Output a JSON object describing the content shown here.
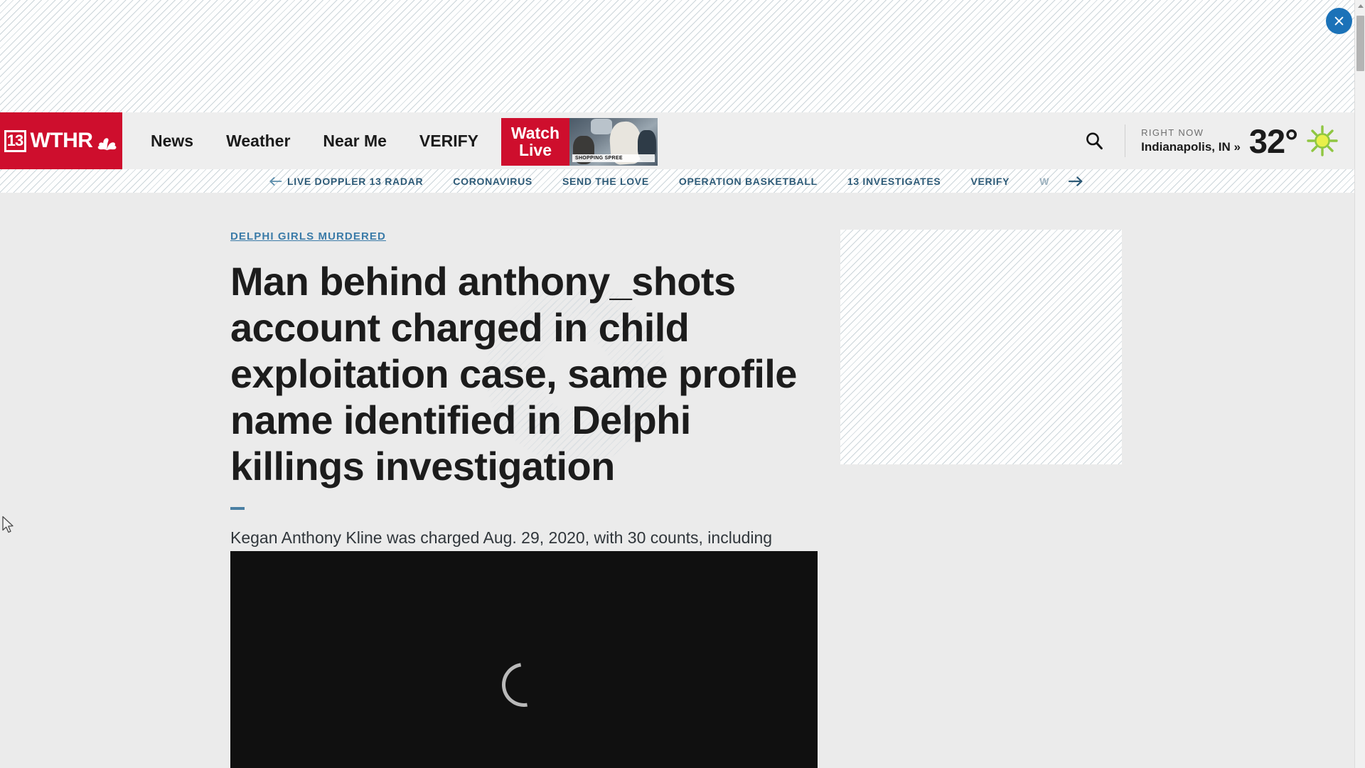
{
  "ad_top": {
    "close_label": "Close ad",
    "icon": "close-icon"
  },
  "scrollbar": {
    "up_icon": "scroll-up-arrow-icon"
  },
  "header": {
    "logo": {
      "channel_number": "13",
      "callsign": "WTHR",
      "network_icon": "nbc-peacock-icon"
    },
    "nav": [
      {
        "label": "News"
      },
      {
        "label": "Weather"
      },
      {
        "label": "Near Me"
      },
      {
        "label": "VERIFY"
      }
    ],
    "watch_live": {
      "line1": "Watch",
      "line2": "Live",
      "thumbnail_chyron": "SHOPPING SPREE"
    },
    "search": {
      "icon": "search-icon",
      "label": "Search"
    },
    "weather": {
      "right_now_label": "RIGHT NOW",
      "location": "Indianapolis, IN »",
      "temperature": "32°",
      "condition_icon": "sun-icon"
    }
  },
  "subnav": {
    "prev_icon": "arrow-left-icon",
    "next_icon": "arrow-right-icon",
    "links": [
      {
        "label": "LIVE DOPPLER 13 RADAR"
      },
      {
        "label": "CORONAVIRUS"
      },
      {
        "label": "SEND THE LOVE"
      },
      {
        "label": "OPERATION BASKETBALL"
      },
      {
        "label": "13 INVESTIGATES"
      },
      {
        "label": "VERIFY"
      },
      {
        "label": "W"
      }
    ]
  },
  "article": {
    "kicker": "DELPHI GIRLS MURDERED",
    "headline": "Man behind anthony_shots account charged in child exploitation case, same profile name identified in Delphi killings investigation",
    "deck": "Kegan Anthony Kline was charged Aug. 29, 2020, with 30 counts, including child exploitation, possession of child pornography and obstruction of justice.",
    "player": {
      "state": "loading",
      "spinner_icon": "loading-spinner-icon"
    }
  },
  "rail": {
    "ad_label": "advertisement-placeholder"
  },
  "colors": {
    "brand_red": "#ce0e2d",
    "kicker_blue": "#3b7ba8",
    "subnav_blue": "#2d5a77",
    "close_blue": "#1b72b8",
    "page_bg": "#ebebeb",
    "header_bg": "#eeeeee",
    "player_bg": "#101010"
  }
}
